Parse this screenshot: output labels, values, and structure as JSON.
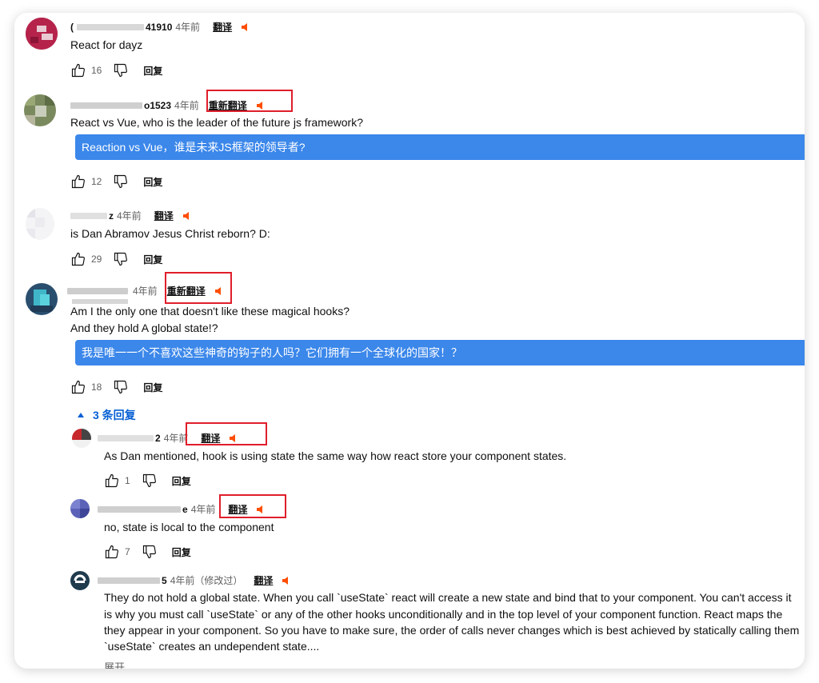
{
  "comments": [
    {
      "handle": "41910",
      "time": "4年前",
      "translate_label": "翻译",
      "text": "React for dayz",
      "likes": "16",
      "reply_label": "回复"
    },
    {
      "handle": "o1523",
      "time": "4年前",
      "translate_label": "重新翻译",
      "text": "React vs Vue, who is the leader of the future js framework?",
      "translation": "Reaction vs Vue，谁是未来JS框架的领导者?",
      "likes": "12",
      "reply_label": "回复"
    },
    {
      "handle": "z",
      "time": "4年前",
      "translate_label": "翻译",
      "text": "is Dan Abramov Jesus Christ reborn? D:",
      "likes": "29",
      "reply_label": "回复"
    },
    {
      "handle": "",
      "time": "4年前",
      "translate_label": "重新翻译",
      "text_line1": "Am I the only one that doesn't like these magical hooks?",
      "text_line2": "And they hold A global state!?",
      "translation": "我是唯一一个不喜欢这些神奇的钩子的人吗？它们拥有一个全球化的国家！？",
      "likes": "18",
      "reply_label": "回复",
      "replies_toggle": "3 条回复"
    }
  ],
  "replies": [
    {
      "handle": "2",
      "time": "4年前",
      "translate_label": "翻译",
      "text": "As Dan mentioned, hook is using state the same way how react store your component states.",
      "likes": "1",
      "reply_label": "回复"
    },
    {
      "handle": "e",
      "time": "4年前",
      "translate_label": "翻译",
      "text": "no, state is local to the component",
      "likes": "7",
      "reply_label": "回复"
    },
    {
      "handle": "5",
      "time": "4年前（修改过）",
      "translate_label": "翻译",
      "line1": "They do not hold a global state. When you call `useState` react will create a new state and bind that to your component. You can't access it",
      "line2": "is why you must call `useState` or any of the other hooks unconditionally and in the top level of your component function. React maps the",
      "line3": "they appear in your component. So you have to make sure, the order of calls never changes which is best achieved by statically calling them",
      "line4": "`useState` creates an undependent state....",
      "expand_label": "展开"
    }
  ],
  "colors": {
    "translation_bar": "#3b87ea",
    "highlight_box": "#e01e2b",
    "speaker": "#ff4e00",
    "link": "#065fd4"
  }
}
